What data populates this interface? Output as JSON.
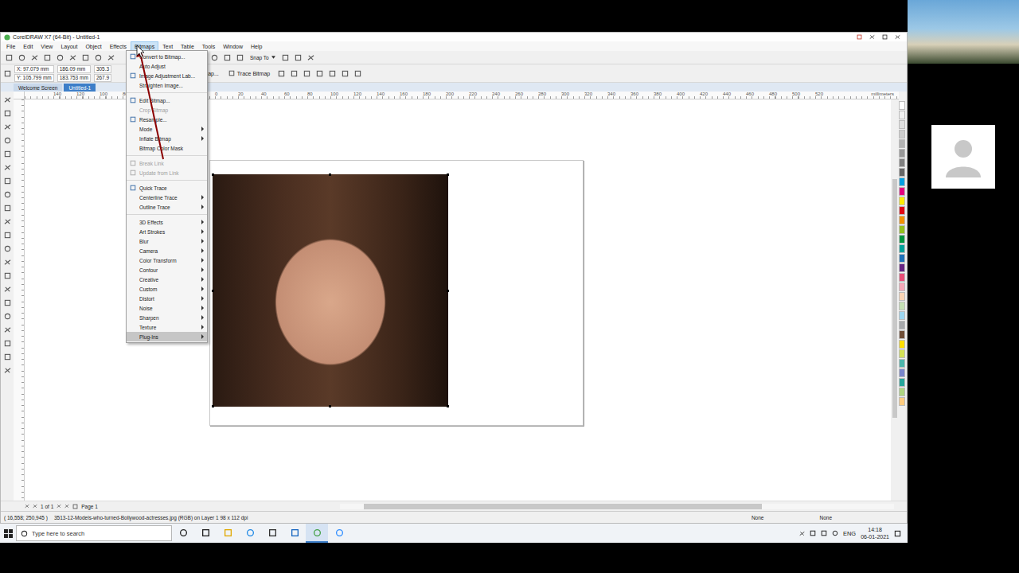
{
  "window": {
    "title": "CorelDRAW X7 (64-Bit) - Untitled-1"
  },
  "menubar": [
    {
      "label": "File",
      "selected": false
    },
    {
      "label": "Edit",
      "selected": false
    },
    {
      "label": "View",
      "selected": false
    },
    {
      "label": "Layout",
      "selected": false
    },
    {
      "label": "Object",
      "selected": false
    },
    {
      "label": "Effects",
      "selected": false
    },
    {
      "label": "Bitmaps",
      "selected": true
    },
    {
      "label": "Text",
      "selected": false
    },
    {
      "label": "Table",
      "selected": false
    },
    {
      "label": "Tools",
      "selected": false
    },
    {
      "label": "Window",
      "selected": false
    },
    {
      "label": "Help",
      "selected": false
    }
  ],
  "toolbar": {
    "snap": "Snap To"
  },
  "property_bar": {
    "x": "X: 97.079 mm",
    "y": "Y: 105.799 mm",
    "width": "186.09 mm",
    "height": "183.753 mm",
    "scale_x": "305.3",
    "scale_y": "267.9",
    "buttons": [
      "Edit Bitmap...",
      "Trace Bitmap"
    ]
  },
  "doc_tabs": [
    {
      "label": "Welcome Screen",
      "selected": false
    },
    {
      "label": "Untitled-1",
      "selected": true
    }
  ],
  "bitmaps_menu": [
    [
      {
        "label": "Convert to Bitmap...",
        "disabled": false,
        "submenu": false,
        "highlighted": false,
        "icon": true
      },
      {
        "label": "Auto Adjust",
        "disabled": false,
        "submenu": false,
        "highlighted": false,
        "icon": false
      },
      {
        "label": "Image Adjustment Lab...",
        "disabled": false,
        "submenu": false,
        "highlighted": false,
        "icon": true
      },
      {
        "label": "Straighten Image...",
        "disabled": false,
        "submenu": false,
        "highlighted": false,
        "icon": false
      }
    ],
    [
      {
        "label": "Edit Bitmap...",
        "disabled": false,
        "submenu": false,
        "highlighted": false,
        "icon": true
      },
      {
        "label": "Crop Bitmap",
        "disabled": true,
        "submenu": false,
        "highlighted": false,
        "icon": false
      },
      {
        "label": "Resample...",
        "disabled": false,
        "submenu": false,
        "highlighted": false,
        "icon": true
      },
      {
        "label": "Mode",
        "disabled": false,
        "submenu": true,
        "highlighted": false,
        "icon": false
      },
      {
        "label": "Inflate Bitmap",
        "disabled": false,
        "submenu": true,
        "highlighted": false,
        "icon": false
      },
      {
        "label": "Bitmap Color Mask",
        "disabled": false,
        "submenu": false,
        "highlighted": false,
        "icon": false
      }
    ],
    [
      {
        "label": "Break Link",
        "disabled": true,
        "submenu": false,
        "highlighted": false,
        "icon": true
      },
      {
        "label": "Update from Link",
        "disabled": true,
        "submenu": false,
        "highlighted": false,
        "icon": true
      }
    ],
    [
      {
        "label": "Quick Trace",
        "disabled": false,
        "submenu": false,
        "highlighted": false,
        "icon": true
      },
      {
        "label": "Centerline Trace",
        "disabled": false,
        "submenu": true,
        "highlighted": false,
        "icon": false
      },
      {
        "label": "Outline Trace",
        "disabled": false,
        "submenu": true,
        "highlighted": false,
        "icon": false
      }
    ],
    [
      {
        "label": "3D Effects",
        "disabled": false,
        "submenu": true,
        "highlighted": false,
        "icon": false
      },
      {
        "label": "Art Strokes",
        "disabled": false,
        "submenu": true,
        "highlighted": false,
        "icon": false
      },
      {
        "label": "Blur",
        "disabled": false,
        "submenu": true,
        "highlighted": false,
        "icon": false
      },
      {
        "label": "Camera",
        "disabled": false,
        "submenu": true,
        "highlighted": false,
        "icon": false
      },
      {
        "label": "Color Transform",
        "disabled": false,
        "submenu": true,
        "highlighted": false,
        "icon": false
      },
      {
        "label": "Contour",
        "disabled": false,
        "submenu": true,
        "highlighted": false,
        "icon": false
      },
      {
        "label": "Creative",
        "disabled": false,
        "submenu": true,
        "highlighted": false,
        "icon": false
      },
      {
        "label": "Custom",
        "disabled": false,
        "submenu": true,
        "highlighted": false,
        "icon": false
      },
      {
        "label": "Distort",
        "disabled": false,
        "submenu": true,
        "highlighted": false,
        "icon": false
      },
      {
        "label": "Noise",
        "disabled": false,
        "submenu": true,
        "highlighted": false,
        "icon": false
      },
      {
        "label": "Sharpen",
        "disabled": false,
        "submenu": true,
        "highlighted": false,
        "icon": false
      },
      {
        "label": "Texture",
        "disabled": false,
        "submenu": true,
        "highlighted": false,
        "icon": false
      },
      {
        "label": "Plug-Ins",
        "disabled": false,
        "submenu": true,
        "highlighted": true,
        "icon": false
      }
    ]
  ],
  "ruler": {
    "labels": [
      "140",
      "120",
      "100",
      "80",
      "60",
      "40",
      "20",
      "0",
      "20",
      "40",
      "60",
      "80",
      "100",
      "120",
      "140",
      "160",
      "180",
      "200",
      "220",
      "240",
      "260",
      "280",
      "300",
      "320",
      "340",
      "360",
      "380",
      "400",
      "420",
      "440",
      "460",
      "480",
      "500",
      "520"
    ],
    "unit": "millimeters"
  },
  "page_nav": {
    "count": "1 of 1",
    "page": "Page 1"
  },
  "status_bar": {
    "coords": "( 16,558; 250,945 )",
    "info": "3513-12-Models-who-turned-Bollywood-actresses.jpg (RGB) on Layer 1 98 x 112 dpi",
    "fill": "None",
    "outline": "None"
  },
  "palette": [
    "#ffffff",
    "#f2f2f2",
    "#e0e0e0",
    "#cccccc",
    "#b3b3b3",
    "#999999",
    "#808080",
    "#666666",
    "#00a0e3",
    "#e6007e",
    "#ffed00",
    "#e30613",
    "#f39200",
    "#95c11f",
    "#009640",
    "#00a19a",
    "#1d71b8",
    "#662483",
    "#e94e77",
    "#f7a8b8",
    "#fbd5b5",
    "#c5e0b4",
    "#9dd6f0",
    "#a7a9ac",
    "#6f4e37",
    "#ffde00",
    "#d4e157",
    "#4db6ac",
    "#7986cb",
    "#26a69a",
    "#aed581",
    "#ffcc80"
  ],
  "taskbar": {
    "search": "Type here to search",
    "lang": "ENG",
    "time": "14:18",
    "date": "06-01-2021"
  }
}
